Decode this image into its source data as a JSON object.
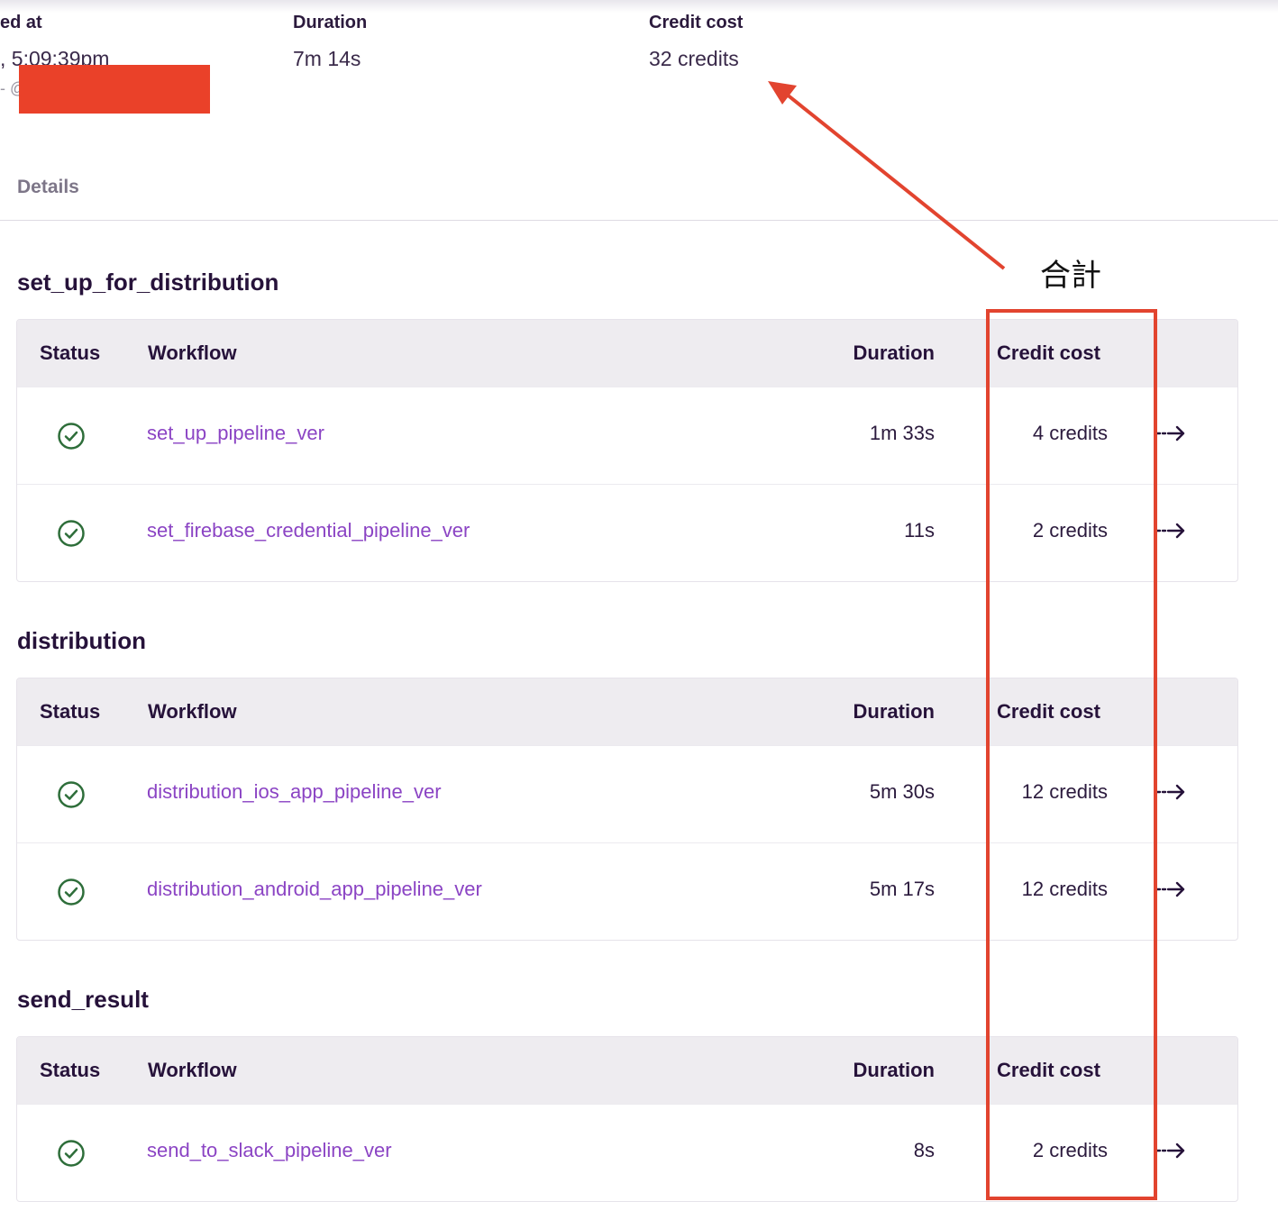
{
  "summary": {
    "started": {
      "label": "ed at",
      "value": ", 5:09:39pm",
      "sub": "- @"
    },
    "duration": {
      "label": "Duration",
      "value": "7m 14s"
    },
    "credit": {
      "label": "Credit cost",
      "value": "32 credits"
    }
  },
  "details_tab": "Details",
  "annotation": {
    "label": "合計",
    "color": "#e2442f"
  },
  "colors": {
    "link": "#8b44c4",
    "success": "#2e6e3a",
    "heading": "#26123a",
    "redaction": "#ea4129"
  },
  "sections": [
    {
      "title": "set_up_for_distribution",
      "headers": {
        "status": "Status",
        "workflow": "Workflow",
        "duration": "Duration",
        "credit": "Credit cost"
      },
      "rows": [
        {
          "status": "success",
          "workflow": "set_up_pipeline_ver",
          "duration": "1m 33s",
          "credit": "4 credits"
        },
        {
          "status": "success",
          "workflow": "set_firebase_credential_pipeline_ver",
          "duration": "11s",
          "credit": "2 credits"
        }
      ]
    },
    {
      "title": "distribution",
      "headers": {
        "status": "Status",
        "workflow": "Workflow",
        "duration": "Duration",
        "credit": "Credit cost"
      },
      "rows": [
        {
          "status": "success",
          "workflow": "distribution_ios_app_pipeline_ver",
          "duration": "5m 30s",
          "credit": "12 credits"
        },
        {
          "status": "success",
          "workflow": "distribution_android_app_pipeline_ver",
          "duration": "5m 17s",
          "credit": "12 credits"
        }
      ]
    },
    {
      "title": "send_result",
      "headers": {
        "status": "Status",
        "workflow": "Workflow",
        "duration": "Duration",
        "credit": "Credit cost"
      },
      "rows": [
        {
          "status": "success",
          "workflow": "send_to_slack_pipeline_ver",
          "duration": "8s",
          "credit": "2 credits"
        }
      ]
    }
  ]
}
